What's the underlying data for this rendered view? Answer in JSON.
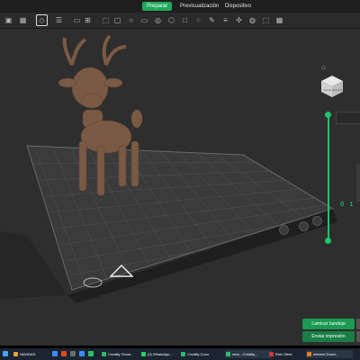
{
  "topbar": {
    "tabs": [
      {
        "label": "Preparar",
        "active": true
      },
      {
        "label": "Previsualización",
        "active": false
      },
      {
        "label": "Dispositivo",
        "active": false
      }
    ]
  },
  "toolbar": {
    "icons": [
      "cube-add-icon",
      "grid-icon",
      "list-icon",
      "slice-icon",
      "plate-icon",
      "grid-dots-icon",
      "frame-icon",
      "box-icon",
      "circle-icon",
      "monitor-icon",
      "sphere-icon",
      "hexagon-icon",
      "square-icon",
      "dots-icon",
      "brush-icon",
      "stack-icon",
      "tools-icon",
      "globe-icon",
      "dashed-box-icon",
      "grid-small-icon"
    ]
  },
  "viewport": {
    "cube_label": "Frente Derecha",
    "coord_text": "0 1"
  },
  "actions": {
    "laminar": "Laminar bandeja",
    "enviar": "Enviar impresión"
  },
  "taskbar": {
    "items": [
      {
        "label": "NAVIDAD",
        "color": "#e8a23a"
      },
      {
        "label": "Creality Cloud...",
        "color": "#2ebd6b"
      },
      {
        "label": "(2) WhatsApp...",
        "color": "#25d366"
      },
      {
        "label": "Creality Cuco",
        "color": "#2ebd6b"
      },
      {
        "label": "reno - Creality...",
        "color": "#2ebd6b"
      },
      {
        "label": "Riot Client",
        "color": "#d13639"
      },
      {
        "label": "Internet Down...",
        "color": "#e67e22"
      }
    ]
  },
  "colors": {
    "accent": "#1fa85a",
    "model": "#7a5a45",
    "grid": "#5a5a5a"
  }
}
